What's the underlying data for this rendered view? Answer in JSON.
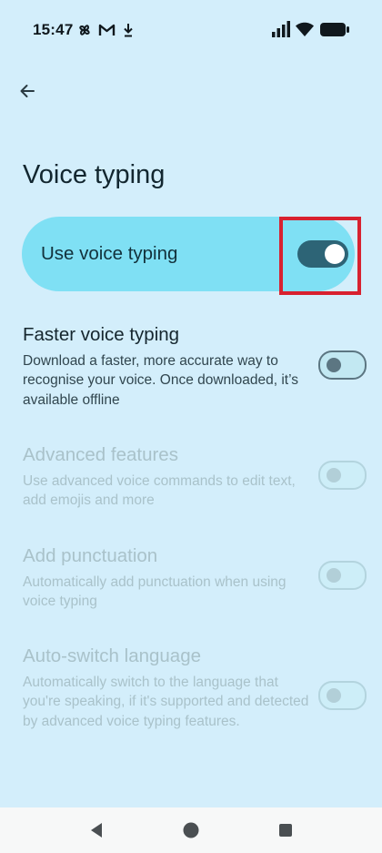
{
  "status_bar": {
    "time": "15:47",
    "notification_icons": [
      "pinwheel-icon",
      "gmail-icon",
      "download-icon"
    ],
    "right_icons": [
      "signal-icon",
      "wifi-icon",
      "battery-icon"
    ]
  },
  "header": {
    "back_icon": "arrow-back-icon"
  },
  "page": {
    "title": "Voice typing"
  },
  "primary_toggle": {
    "label": "Use voice typing",
    "state": "on"
  },
  "settings": [
    {
      "title": "Faster voice typing",
      "description": "Download a faster, more accurate way to recognise your voice. Once downloaded, it’s available offline",
      "state": "off",
      "enabled": true
    },
    {
      "title": "Advanced features",
      "description": "Use advanced voice commands to edit text, add emojis and more",
      "state": "off",
      "enabled": false
    },
    {
      "title": "Add punctuation",
      "description": "Automatically add punctuation when using voice typing",
      "state": "off",
      "enabled": false
    },
    {
      "title": "Auto-switch language",
      "description": "Automatically switch to the language that you're speaking, if it's supported and detected by advanced voice typing features.",
      "state": "off",
      "enabled": false
    }
  ],
  "colors": {
    "background": "#d3eefb",
    "primary_card": "#7fe0f4",
    "toggle_on": "#2d6476",
    "highlight": "#d8212f"
  },
  "nav_bar": {
    "icons": [
      "back-triangle-icon",
      "home-circle-icon",
      "recents-square-icon"
    ]
  }
}
